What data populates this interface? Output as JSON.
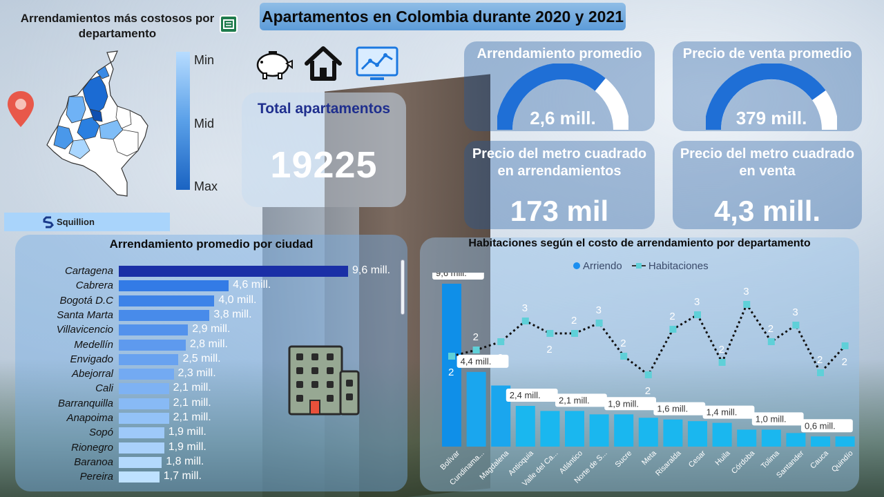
{
  "header": {
    "title": "Apartamentos en Colombia durante 2020 y 2021"
  },
  "map_panel": {
    "title": "Arrendamientos más costosos por departamento",
    "legend": [
      "Min",
      "Mid",
      "Max"
    ],
    "brand": "Squillion"
  },
  "icons": [
    "pin-icon",
    "piggy-bank-icon",
    "house-icon",
    "monitor-chart-icon",
    "building-icon",
    "report-icon"
  ],
  "total": {
    "label": "Total apartamentos",
    "value": "19225"
  },
  "kpis": {
    "rent_avg": {
      "title": "Arrendamiento promedio",
      "value": "2,6 mill.",
      "fraction": 0.72
    },
    "sale_avg": {
      "title": "Precio de venta promedio",
      "value": "379 mill.",
      "fraction": 0.8
    },
    "rent_m2": {
      "title": "Precio del metro cuadrado en arrendamientos",
      "value": "173 mil"
    },
    "sale_m2": {
      "title": "Precio del metro cuadrado en venta",
      "value": "4,3 mill."
    }
  },
  "colors": {
    "bar_dark": "#1a2fa6",
    "bar_mid": "#2f7be6",
    "bar_light": "#9fd1ff",
    "cyan": "#1ab7ef",
    "gauge_fill": "#1f6fd6",
    "gauge_bg": "#ffffff"
  },
  "chart_data": [
    {
      "type": "bar",
      "orientation": "horizontal",
      "title": "Arrendamiento promedio por ciudad",
      "categories": [
        "Cartagena",
        "Cabrera",
        "Bogotá D.C",
        "Santa Marta",
        "Villavicencio",
        "Medellín",
        "Envigado",
        "Abejorral",
        "Cali",
        "Barranquilla",
        "Anapoima",
        "Sopó",
        "Rionegro",
        "Baranoa",
        "Pereira"
      ],
      "values": [
        9.6,
        4.6,
        4.0,
        3.8,
        2.9,
        2.8,
        2.5,
        2.3,
        2.1,
        2.1,
        2.1,
        1.9,
        1.9,
        1.8,
        1.7
      ],
      "labels": [
        "9,6 mill.",
        "4,6 mill.",
        "4,0 mill.",
        "3,8 mill.",
        "2,9 mill.",
        "2,8 mill.",
        "2,5 mill.",
        "2,3 mill.",
        "2,1 mill.",
        "2,1 mill.",
        "2,1 mill.",
        "1,9 mill.",
        "1,9 mill.",
        "1,8 mill.",
        "1,7 mill."
      ]
    },
    {
      "type": "bar",
      "title": "Habitaciones según el costo de arrendamiento por departamento",
      "legend": [
        "Arriendo",
        "Habitaciones"
      ],
      "categories": [
        "Bolívar",
        "Cundinama...",
        "Magdalena",
        "Antioquia",
        "Valle del Ca...",
        "Atlántico",
        "Norte de S...",
        "Sucre",
        "Meta",
        "Risaralda",
        "Cesar",
        "Huila",
        "Córdoba",
        "Tolima",
        "Santander",
        "Cauca",
        "Quindío"
      ],
      "series": [
        {
          "name": "Arriendo",
          "type": "bar",
          "values": [
            9.6,
            4.4,
            3.6,
            2.4,
            2.1,
            2.1,
            1.9,
            1.9,
            1.7,
            1.6,
            1.5,
            1.4,
            1.0,
            1.0,
            0.8,
            0.6,
            0.6
          ]
        },
        {
          "name": "Habitaciones",
          "type": "line",
          "values": [
            2.15,
            2.3,
            2.5,
            3.0,
            2.7,
            2.7,
            2.95,
            2.15,
            1.7,
            2.8,
            3.15,
            2.0,
            3.4,
            2.5,
            2.9,
            1.75,
            2.4
          ]
        }
      ],
      "bar_labels": {
        "0": "9,6 mill.",
        "1": "4,4 mill.",
        "3": "2,4 mill.",
        "5": "2,1 mill.",
        "7": "1,9 mill.",
        "9": "1,6 mill.",
        "11": "1,4 mill.",
        "13": "1,0 mill.",
        "15": "0,6 mill."
      },
      "line_labels": [
        "2",
        "2",
        "2",
        "3",
        "2",
        "2",
        "3",
        "2",
        "2",
        "2",
        "3",
        "2",
        "3",
        "2",
        "3",
        "2",
        "2"
      ]
    }
  ]
}
